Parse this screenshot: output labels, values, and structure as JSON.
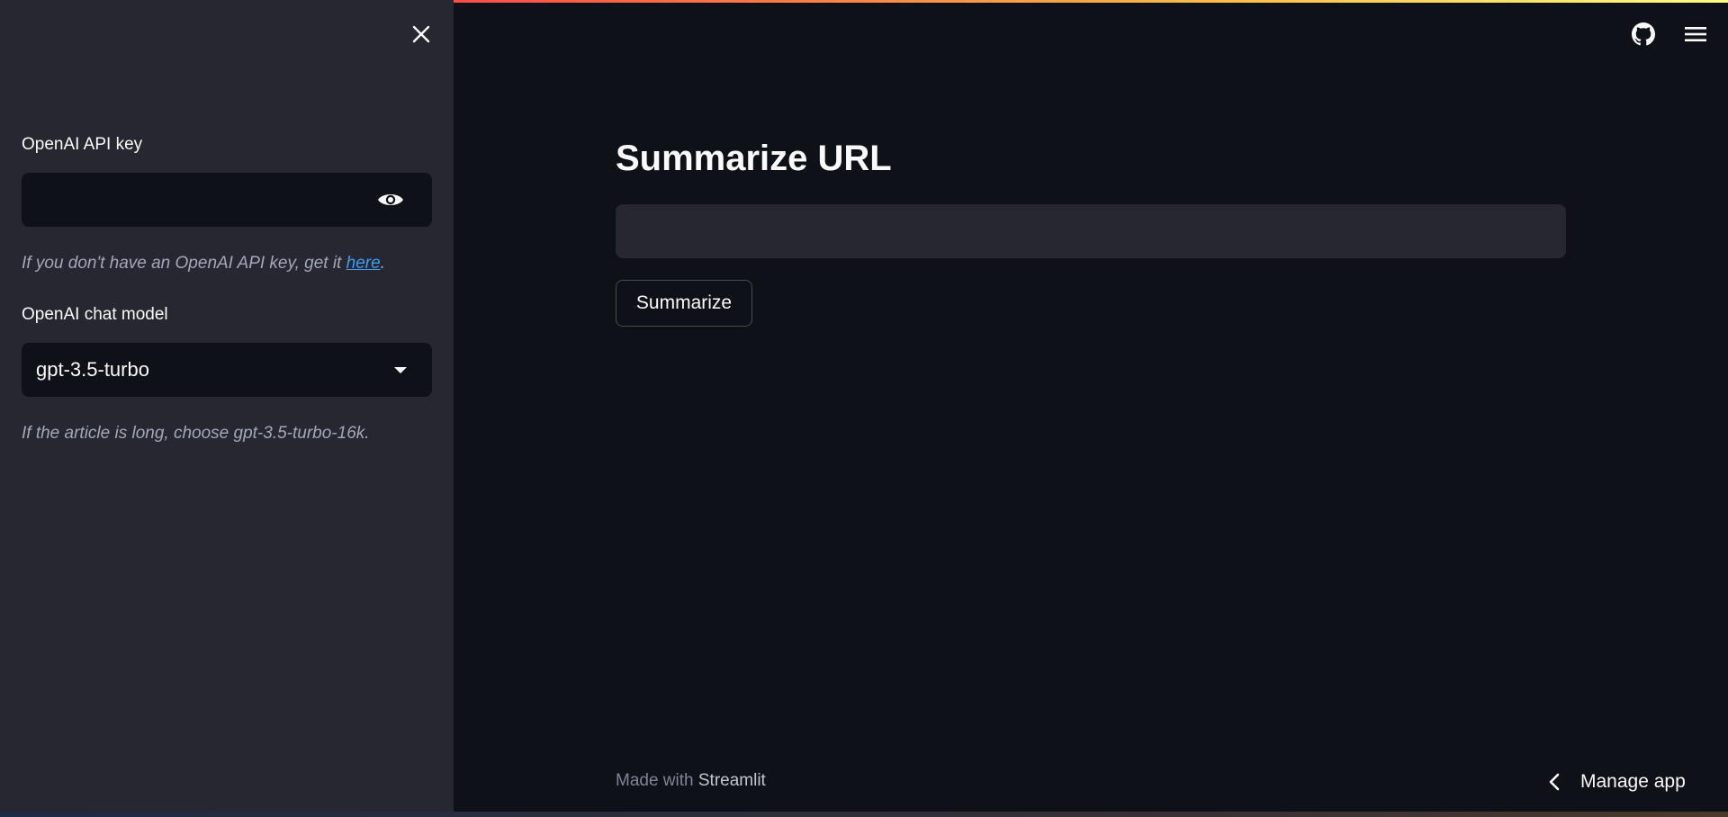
{
  "sidebar": {
    "api_key": {
      "label": "OpenAI API key",
      "value": "",
      "placeholder": ""
    },
    "api_key_caption": {
      "prefix": "If you don't have an OpenAI API key, get it ",
      "link_text": "here",
      "suffix": "."
    },
    "model": {
      "label": "OpenAI chat model",
      "selected": "gpt-3.5-turbo"
    },
    "model_caption": "If the article is long, choose gpt-3.5-turbo-16k.",
    "icons": {
      "close": "close-icon",
      "visibility": "eye-icon",
      "dropdown": "chevron-down-icon"
    }
  },
  "header": {
    "icons": [
      "github-icon",
      "hamburger-menu-icon"
    ]
  },
  "main": {
    "title": "Summarize URL",
    "url_input": {
      "value": "",
      "placeholder": ""
    },
    "summarize_label": "Summarize"
  },
  "footer": {
    "prefix": "Made with ",
    "brand": "Streamlit"
  },
  "manage_app": {
    "label": "Manage app",
    "icon": "chevron-left-icon"
  },
  "colors": {
    "app_background": "#0e1117",
    "sidebar_background": "#262730",
    "text": "#fafafa",
    "caption": "#a3a8b8",
    "link": "#3d9df3",
    "accent_gradient_start": "#ff4b4b",
    "accent_gradient_end": "#fffd80"
  }
}
